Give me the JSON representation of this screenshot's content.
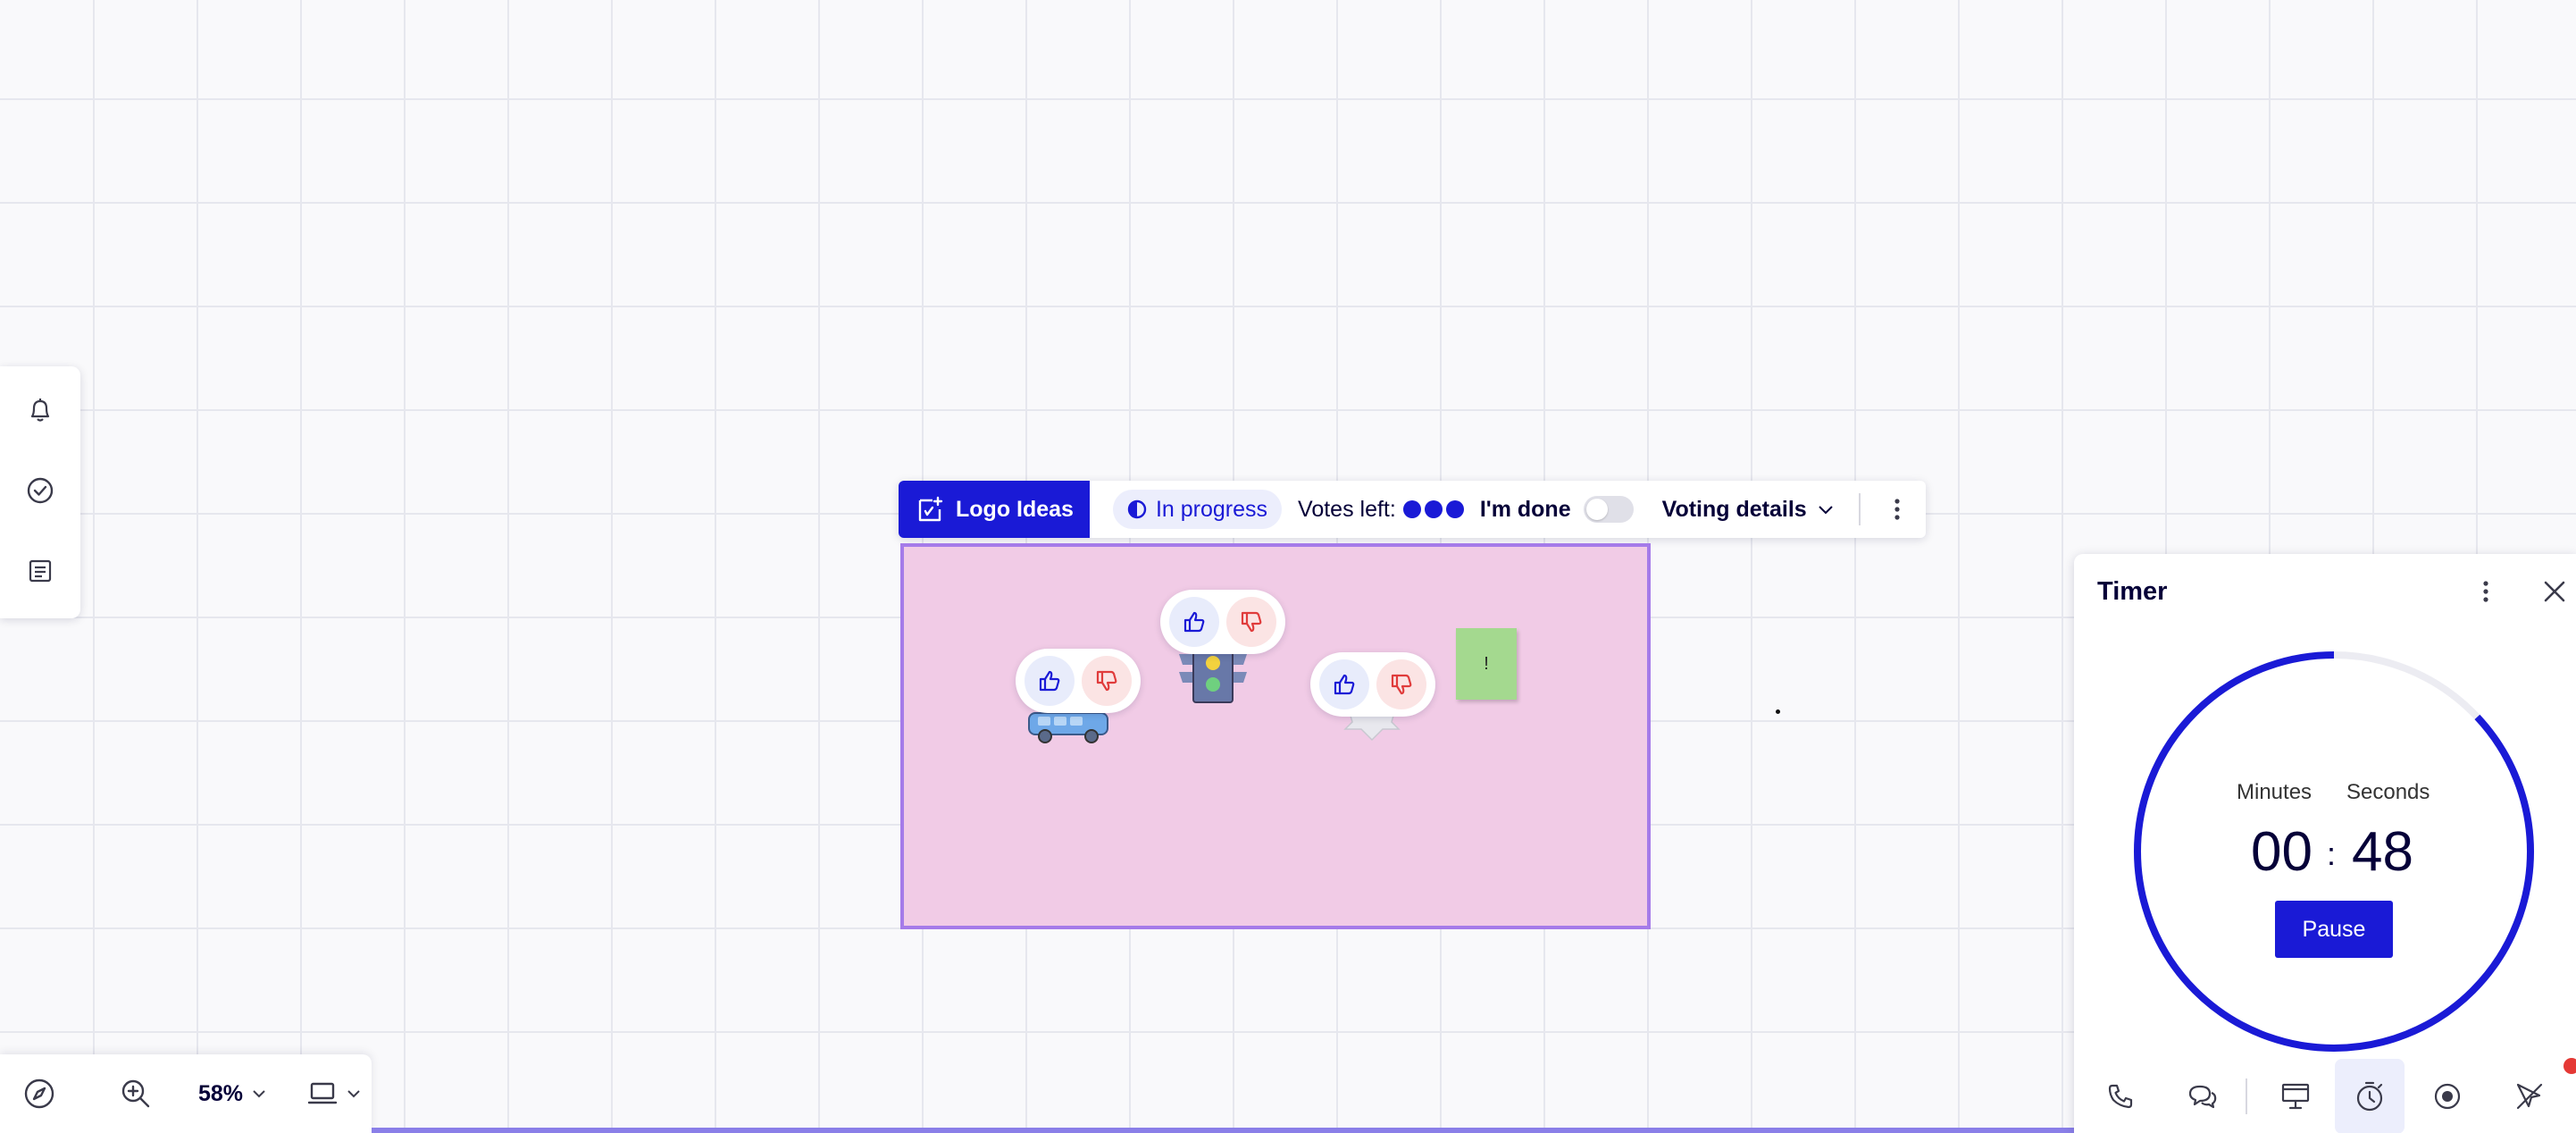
{
  "board": {
    "zoom_level": "58%"
  },
  "voting": {
    "frame_title": "Logo Ideas",
    "status": "In progress",
    "votes_left_label": "Votes left:",
    "votes_left_count": 3,
    "done_label": "I'm done",
    "done_toggle_on": false,
    "details_label": "Voting details",
    "accent_color": "#1a1ad6"
  },
  "frame": {
    "background_color": "#f1cbe6",
    "border_color": "#a57be9",
    "sticky_note_text": "!"
  },
  "timer": {
    "title": "Timer",
    "minutes_label": "Minutes",
    "seconds_label": "Seconds",
    "minutes": "00",
    "separator": ":",
    "seconds": "48",
    "pause_label": "Pause",
    "remaining_fraction": 0.87
  },
  "icons": {
    "left_panel": [
      "bell-icon",
      "check-circle-icon",
      "list-icon"
    ],
    "bottom_left": [
      "compass-icon",
      "zoom-in-icon",
      "device-icon"
    ],
    "timer_toolbar": [
      "phone-icon",
      "chat-icon",
      "presentation-icon",
      "timer-icon",
      "record-icon",
      "hide-collaborators-icon"
    ]
  }
}
